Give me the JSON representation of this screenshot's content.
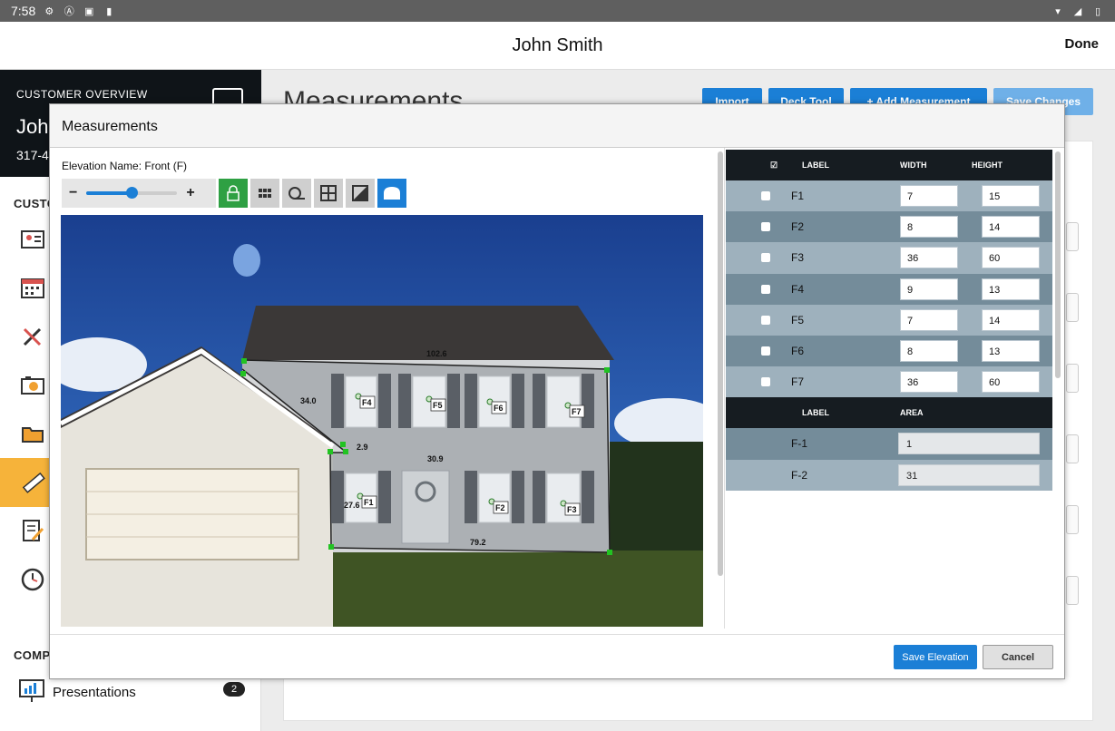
{
  "status_bar": {
    "time": "7:58"
  },
  "app_bar": {
    "title": "John Smith",
    "done_label": "Done"
  },
  "sidebar": {
    "customer_overview_label": "CUSTOMER OVERVIEW",
    "customer_name": "Joh",
    "customer_phone": "317-4",
    "section_customer": "CUSTO",
    "section_company": "COMPA",
    "presentations_label": "Presentations",
    "presentations_count": "2",
    "active_color": "#f6b33a"
  },
  "page": {
    "title": "Measurements",
    "buttons": {
      "import": "Import",
      "deck_tool": "Deck Tool",
      "add_measurement": "+ Add Measurement",
      "save_changes": "Save Changes"
    }
  },
  "modal": {
    "title": "Measurements",
    "elevation_name": "Elevation Name: Front (F)",
    "zoom_minus": "−",
    "zoom_plus": "+",
    "zoom_level": 0.5,
    "photo": {
      "markers": [
        "F1",
        "F2",
        "F3",
        "F4",
        "F5",
        "F6",
        "F7"
      ],
      "dimensions": [
        "102.6",
        "34.0",
        "2.9",
        "30.9",
        "27.6",
        "79.2"
      ]
    },
    "table": {
      "headers": {
        "label": "LABEL",
        "width": "WIDTH",
        "height": "HEIGHT"
      },
      "rows": [
        {
          "label": "F1",
          "width": "7",
          "height": "15"
        },
        {
          "label": "F2",
          "width": "8",
          "height": "14"
        },
        {
          "label": "F3",
          "width": "36",
          "height": "60"
        },
        {
          "label": "F4",
          "width": "9",
          "height": "13"
        },
        {
          "label": "F5",
          "width": "7",
          "height": "14"
        },
        {
          "label": "F6",
          "width": "8",
          "height": "13"
        },
        {
          "label": "F7",
          "width": "36",
          "height": "60"
        }
      ],
      "area_headers": {
        "label": "LABEL",
        "area": "AREA"
      },
      "area_rows": [
        {
          "label": "F-1",
          "area": "1"
        },
        {
          "label": "F-2",
          "area": "31"
        }
      ]
    },
    "save_label": "Save Elevation",
    "cancel_label": "Cancel"
  },
  "colors": {
    "accent": "#1b7fd6",
    "header_dark": "#161c21",
    "row_light": "#9eb1bd",
    "row_dark": "#748c9a",
    "lock_green": "#2ea043"
  }
}
